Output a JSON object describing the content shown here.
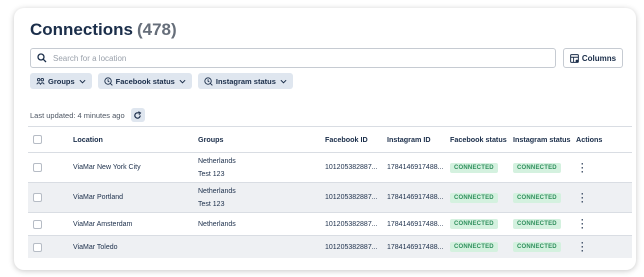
{
  "header": {
    "title": "Connections",
    "count": "(478)"
  },
  "search": {
    "placeholder": "Search for a location"
  },
  "toolbar": {
    "columns_label": "Columns"
  },
  "filters": [
    {
      "label": "Groups",
      "icon": "people-icon"
    },
    {
      "label": "Facebook status",
      "icon": "status-clock-icon"
    },
    {
      "label": "Instagram status",
      "icon": "status-clock-icon"
    }
  ],
  "status": {
    "last_updated": "Last updated: 4 minutes ago"
  },
  "table": {
    "headers": [
      "Location",
      "Groups",
      "Facebook ID",
      "Instagram ID",
      "Facebook status",
      "Instagram status",
      "Actions"
    ],
    "rows": [
      {
        "location": "ViaMar New York City",
        "groups": [
          "Netherlands",
          "Test 123"
        ],
        "facebook_id": "101205382887...",
        "instagram_id": "1784146917488...",
        "facebook_status": "CONNECTED",
        "instagram_status": "CONNECTED"
      },
      {
        "location": "ViaMar Portland",
        "groups": [
          "Netherlands",
          "Test 123"
        ],
        "facebook_id": "101205382887...",
        "instagram_id": "1784146917488...",
        "facebook_status": "CONNECTED",
        "instagram_status": "CONNECTED"
      },
      {
        "location": "ViaMar Amsterdam",
        "groups": [
          "Netherlands"
        ],
        "facebook_id": "101205382887...",
        "instagram_id": "1784146917488...",
        "facebook_status": "CONNECTED",
        "instagram_status": "CONNECTED"
      },
      {
        "location": "ViaMar Toledo",
        "groups": [],
        "facebook_id": "101205382887...",
        "instagram_id": "1784146917488...",
        "facebook_status": "CONNECTED",
        "instagram_status": "CONNECTED"
      }
    ]
  },
  "colors": {
    "title": "#1b2e4a",
    "chip_bg": "#dfe6ef",
    "badge_bg": "#d4f1df",
    "badge_text": "#2f8f5c"
  }
}
